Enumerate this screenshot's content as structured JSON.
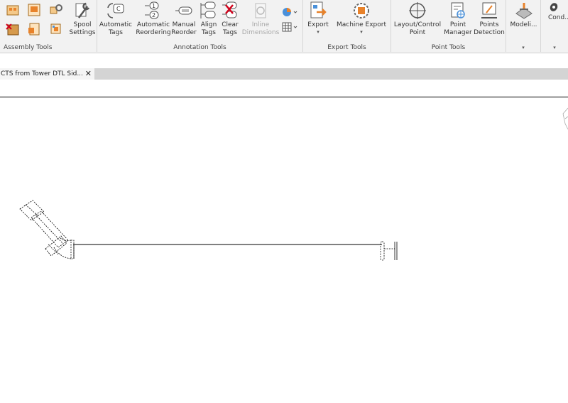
{
  "ribbon": {
    "panels": {
      "assembly": {
        "label": "Assembly Tools"
      },
      "annotation": {
        "label": "Annotation Tools"
      },
      "export": {
        "label": "Export Tools"
      },
      "point": {
        "label": "Point Tools"
      },
      "modeling": {
        "dropdown": "▾"
      },
      "construction": {
        "dropdown": "▾"
      }
    },
    "buttons": {
      "spool_settings": "Spool\nSettings",
      "automatic_tags": "Automatic\nTags",
      "automatic_reordering": "Automatic\nReordering",
      "manual_reorder": "Manual\nReorder",
      "align_tags": "Align\nTags",
      "clear_tags": "Clear\nTags",
      "inline_dimensions": "Inline\nDimensions",
      "export": "Export",
      "machine_export": "Machine Export",
      "layout_control_point": "Layout/Control\nPoint",
      "point_manager": "Point\nManager",
      "points_detection": "Points\nDetection",
      "modeling": "Modeli...",
      "construction": "Cond..."
    }
  },
  "tabs": [
    {
      "label": "CTS from Tower DTL Sid...",
      "close": "✕"
    }
  ],
  "colors": {
    "ribbon_bg": "#f2f2f2",
    "tabbar_bg": "#d4d4d4",
    "accent_orange": "#e8822a",
    "icon_gray": "#666666"
  }
}
